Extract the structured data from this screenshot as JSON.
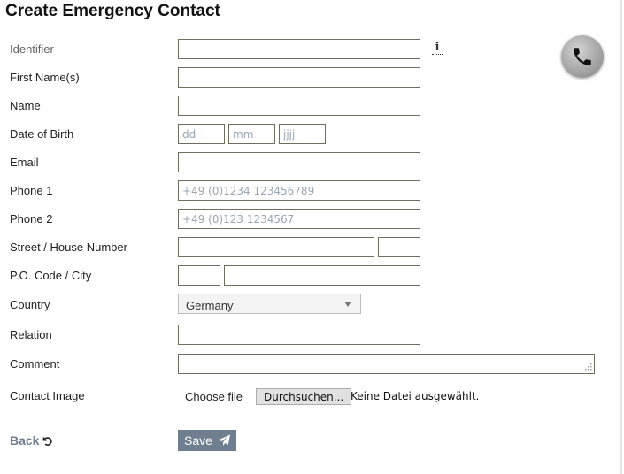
{
  "title": "Create Emergency Contact",
  "info_icon_glyph": "i",
  "phone_icon": "phone-icon",
  "fields": {
    "identifier": {
      "label": "Identifier",
      "value": "",
      "placeholder": ""
    },
    "first_names": {
      "label": "First Name(s)",
      "value": "",
      "placeholder": ""
    },
    "name": {
      "label": "Name",
      "value": "",
      "placeholder": ""
    },
    "date_of_birth": {
      "label": "Date of Birth",
      "day_placeholder": "dd",
      "month_placeholder": "mm",
      "year_placeholder": "jjjj"
    },
    "email": {
      "label": "Email",
      "value": "",
      "placeholder": ""
    },
    "phone1": {
      "label": "Phone 1",
      "value": "",
      "placeholder": "+49 (0)1234 123456789"
    },
    "phone2": {
      "label": "Phone 2",
      "value": "",
      "placeholder": "+49 (0)123 1234567"
    },
    "street": {
      "label": "Street / House Number",
      "street_value": "",
      "number_value": ""
    },
    "po_city": {
      "label": "P.O. Code / City",
      "po_value": "",
      "city_value": ""
    },
    "country": {
      "label": "Country",
      "selected": "Germany"
    },
    "relation": {
      "label": "Relation",
      "value": ""
    },
    "comment": {
      "label": "Comment",
      "value": ""
    },
    "contact_image": {
      "label": "Contact Image",
      "choose_label": "Choose file",
      "browse_button": "Durchsuchen...",
      "status": "Keine Datei ausgewählt."
    }
  },
  "actions": {
    "back_label": "Back",
    "back_icon": "undo-icon",
    "save_label": "Save",
    "save_icon": "send-icon"
  },
  "colors": {
    "accent": "#6f7f90",
    "input_border": "#6e6e5e",
    "placeholder": "#9aa7b3"
  }
}
